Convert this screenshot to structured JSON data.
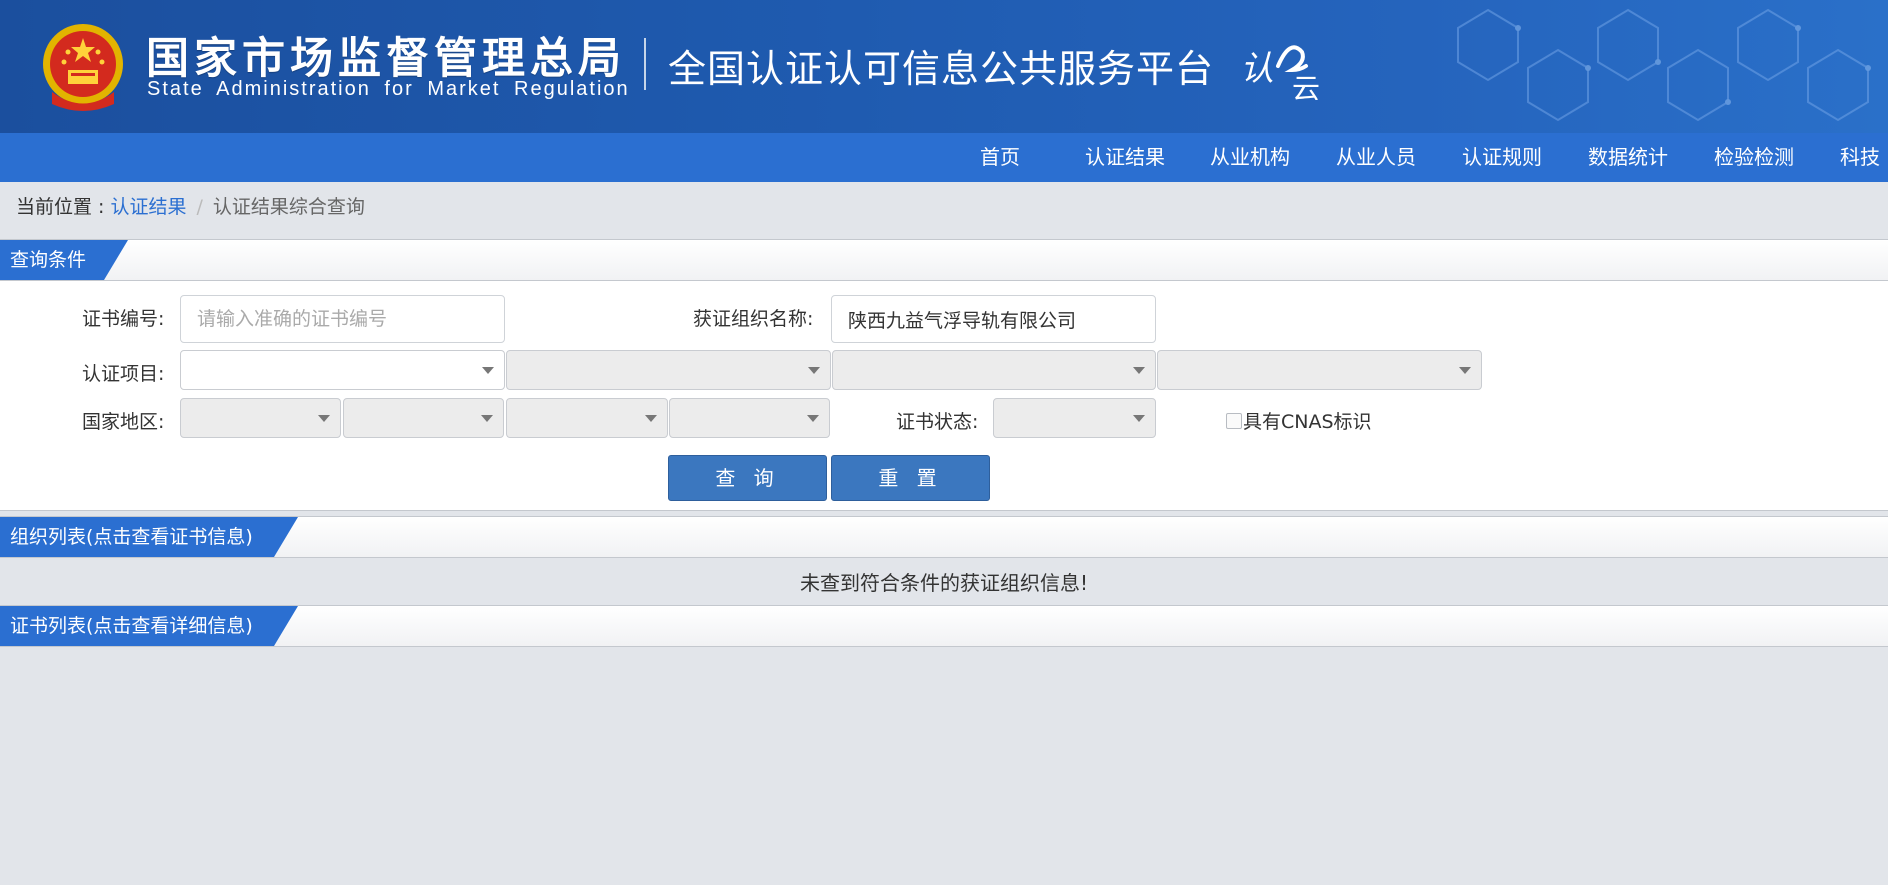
{
  "header": {
    "agency_cn": "国家市场监督管理总局",
    "agency_en": "State Administration  for  Market Regulation",
    "platform_name": "全国认证认可信息公共服务平台",
    "logo_text": "认云",
    "logo_colors": {
      "primary": "#ffffff"
    }
  },
  "nav": {
    "items": [
      {
        "label": "首页"
      },
      {
        "label": "认证结果"
      },
      {
        "label": "从业机构"
      },
      {
        "label": "从业人员"
      },
      {
        "label": "认证规则"
      },
      {
        "label": "数据统计"
      },
      {
        "label": "检验检测"
      },
      {
        "label": "科技"
      }
    ]
  },
  "breadcrumb": {
    "prefix": "当前位置 : ",
    "link": "认证结果",
    "separator": "/",
    "current": "认证结果综合查询"
  },
  "query": {
    "section_title": "查询条件",
    "cert_no_label": "证书编号:",
    "cert_no_placeholder": "请输入准确的证书编号",
    "cert_no_value": "",
    "org_name_label": "获证组织名称:",
    "org_name_value": "陕西九益气浮导轨有限公司",
    "project_label": "认证项目:",
    "region_label": "国家地区:",
    "status_label": "证书状态:",
    "cnas_label": "具有CNAS标识",
    "cnas_checked": false,
    "search_button": "查 询",
    "reset_button": "重 置"
  },
  "org_list": {
    "section_title": "组织列表(点击查看证书信息)",
    "empty_message": "未查到符合条件的获证组织信息!"
  },
  "cert_list": {
    "section_title": "证书列表(点击查看详细信息)"
  },
  "colors": {
    "banner": "#1f5bb0",
    "nav": "#2b6fd1",
    "button": "#3b77bf",
    "page_bg": "#e2e5ea"
  }
}
